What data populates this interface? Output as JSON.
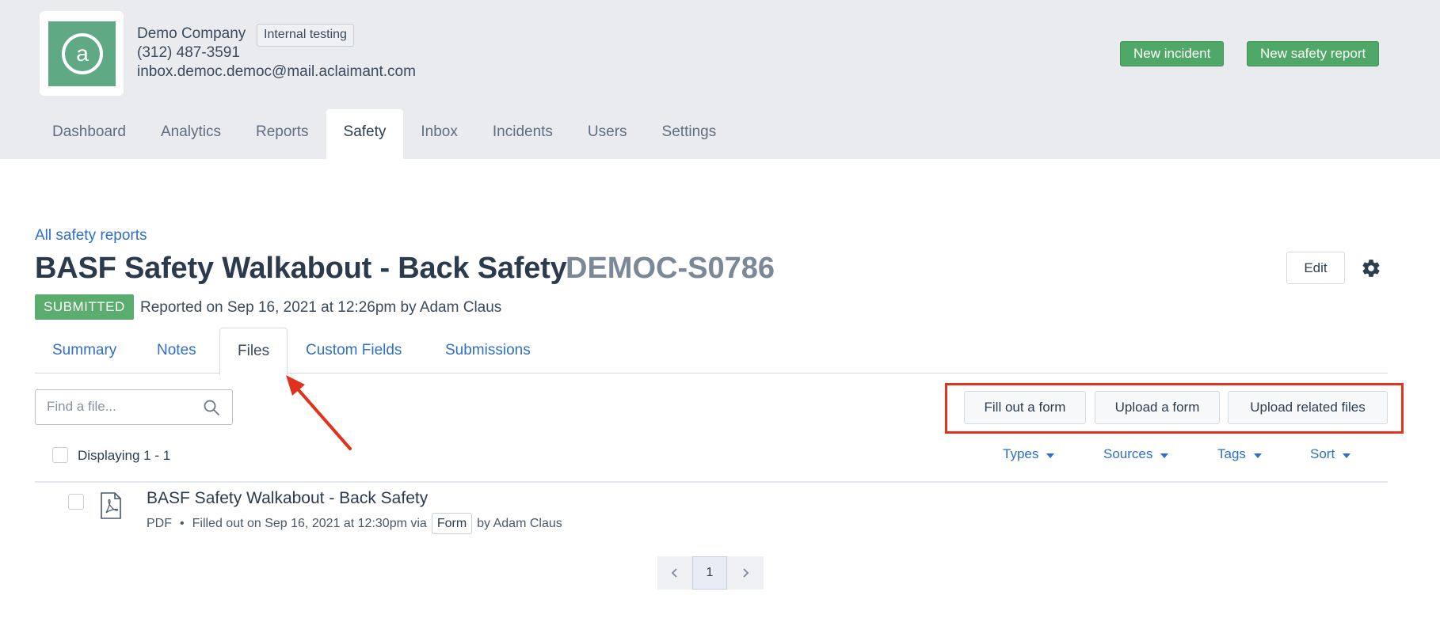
{
  "header": {
    "company_name": "Demo Company",
    "company_badge": "Internal testing",
    "phone": "(312) 487-3591",
    "email": "inbox.democ.democ@mail.aclaimant.com",
    "new_incident_label": "New incident",
    "new_safety_report_label": "New safety report",
    "logo_glyph": "a"
  },
  "nav": {
    "items": [
      "Dashboard",
      "Analytics",
      "Reports",
      "Safety",
      "Inbox",
      "Incidents",
      "Users",
      "Settings"
    ],
    "active": "Safety"
  },
  "report": {
    "breadcrumb": "All safety reports",
    "title": "BASF Safety Walkabout - Back Safety",
    "id": "DEMOC-S0786",
    "status": "SUBMITTED",
    "reported_text": "Reported on Sep 16, 2021 at 12:26pm by Adam Claus",
    "edit_label": "Edit"
  },
  "tabs": {
    "items": [
      "Summary",
      "Notes",
      "Files",
      "Custom Fields",
      "Submissions"
    ],
    "active": "Files"
  },
  "files": {
    "search_placeholder": "Find a file...",
    "actions": {
      "fill_out": "Fill out a form",
      "upload_form": "Upload a form",
      "upload_related": "Upload related files"
    },
    "displaying": "Displaying 1 - 1",
    "filters": {
      "types": "Types",
      "sources": "Sources",
      "tags": "Tags",
      "sort": "Sort"
    },
    "items": [
      {
        "title": "BASF Safety Walkabout - Back Safety",
        "type": "PDF",
        "dot": "•",
        "filled_text": "Filled out on Sep 16, 2021 at 12:30pm via",
        "via_badge": "Form",
        "by_text": "by Adam Claus"
      }
    ],
    "pagination": {
      "current_page": "1"
    }
  },
  "colors": {
    "header_bg": "#e9ebef",
    "brand_green": "#5faa84",
    "button_green": "#4fa868",
    "link_blue": "#2f6fc5",
    "highlight_red": "#e0321c"
  }
}
